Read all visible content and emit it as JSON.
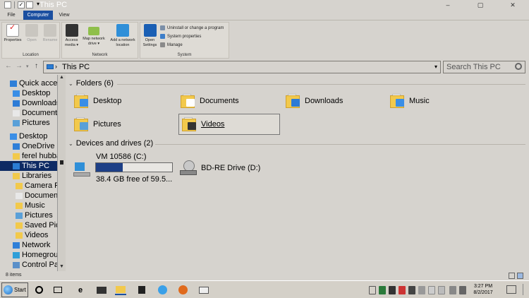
{
  "window": {
    "title": "This PC",
    "controls": {
      "minimize": "–",
      "maximize": "▢",
      "close": "✕"
    }
  },
  "ribbon": {
    "tabs": [
      "File",
      "Computer",
      "View"
    ],
    "active_tab": "Computer",
    "groups": {
      "location": {
        "label": "Location",
        "buttons": [
          "Properties",
          "Open",
          "Rename"
        ]
      },
      "network": {
        "label": "Network",
        "buttons": [
          {
            "line1": "Access",
            "line2": "media ▾"
          },
          {
            "line1": "Map network",
            "line2": "drive ▾"
          },
          {
            "line1": "Add a network",
            "line2": "location"
          }
        ]
      },
      "system": {
        "label": "System",
        "open_settings": {
          "line1": "Open",
          "line2": "Settings"
        },
        "items": [
          "Uninstall or change a program",
          "System properties",
          "Manage"
        ]
      }
    }
  },
  "address": {
    "path": "This PC",
    "search_placeholder": "Search This PC"
  },
  "nav": {
    "items": [
      {
        "label": "Quick access",
        "indent": 0,
        "icon": "star-icon",
        "pin": false
      },
      {
        "label": "Desktop",
        "indent": 1,
        "icon": "desktop-icon",
        "pin": true
      },
      {
        "label": "Downloads",
        "indent": 1,
        "icon": "download-icon",
        "pin": true
      },
      {
        "label": "Documents",
        "indent": 1,
        "icon": "documents-icon",
        "pin": true
      },
      {
        "label": "Pictures",
        "indent": 1,
        "icon": "pictures-icon",
        "pin": true
      },
      {
        "label": "",
        "indent": 0,
        "icon": "",
        "pin": false
      },
      {
        "label": "Desktop",
        "indent": 0,
        "icon": "desktop-icon",
        "pin": false
      },
      {
        "label": "OneDrive",
        "indent": 1,
        "icon": "onedrive-icon",
        "pin": false
      },
      {
        "label": "ferel hubbard",
        "indent": 1,
        "icon": "user-icon",
        "pin": false
      },
      {
        "label": "This PC",
        "indent": 1,
        "icon": "pc-icon",
        "pin": false,
        "selected": true
      },
      {
        "label": "Libraries",
        "indent": 1,
        "icon": "libraries-icon",
        "pin": false
      },
      {
        "label": "Camera Roll",
        "indent": 2,
        "icon": "camera-roll-icon",
        "pin": false
      },
      {
        "label": "Documents",
        "indent": 2,
        "icon": "documents-icon",
        "pin": false
      },
      {
        "label": "Music",
        "indent": 2,
        "icon": "music-icon",
        "pin": false
      },
      {
        "label": "Pictures",
        "indent": 2,
        "icon": "pictures-icon",
        "pin": false
      },
      {
        "label": "Saved Pictures",
        "indent": 2,
        "icon": "saved-pictures-icon",
        "pin": false
      },
      {
        "label": "Videos",
        "indent": 2,
        "icon": "videos-icon",
        "pin": false
      },
      {
        "label": "Network",
        "indent": 1,
        "icon": "network-icon",
        "pin": false
      },
      {
        "label": "Homegroup",
        "indent": 1,
        "icon": "homegroup-icon",
        "pin": false
      },
      {
        "label": "Control Panel",
        "indent": 1,
        "icon": "control-panel-icon",
        "pin": false
      }
    ]
  },
  "folders": {
    "header": "Folders (6)",
    "items": [
      {
        "label": "Desktop",
        "badge": "#3a8ee6"
      },
      {
        "label": "Documents",
        "badge": "#ffffff"
      },
      {
        "label": "Downloads",
        "badge": "#2d7bd6"
      },
      {
        "label": "Music",
        "badge": "#3a8ee6"
      },
      {
        "label": "Pictures",
        "badge": "#5aa0d8"
      },
      {
        "label": "Videos",
        "badge": "#333333",
        "selected": true
      }
    ]
  },
  "drives": {
    "header": "Devices and drives (2)",
    "items": [
      {
        "label": "VM 10586 (C:)",
        "free": "38.4 GB free of 59.5...",
        "used_fraction": 0.35
      },
      {
        "label": "BD-RE Drive (D:)"
      }
    ]
  },
  "status": {
    "items": "8 items"
  },
  "taskbar": {
    "start": "Start",
    "clock_time": "3:27 PM",
    "clock_date": "8/2/2017"
  },
  "colors": {
    "accent": "#1b4fa0",
    "selection": "#0d2a63",
    "folder": "#f2c94c",
    "drive_fill": "#1d3f86"
  }
}
